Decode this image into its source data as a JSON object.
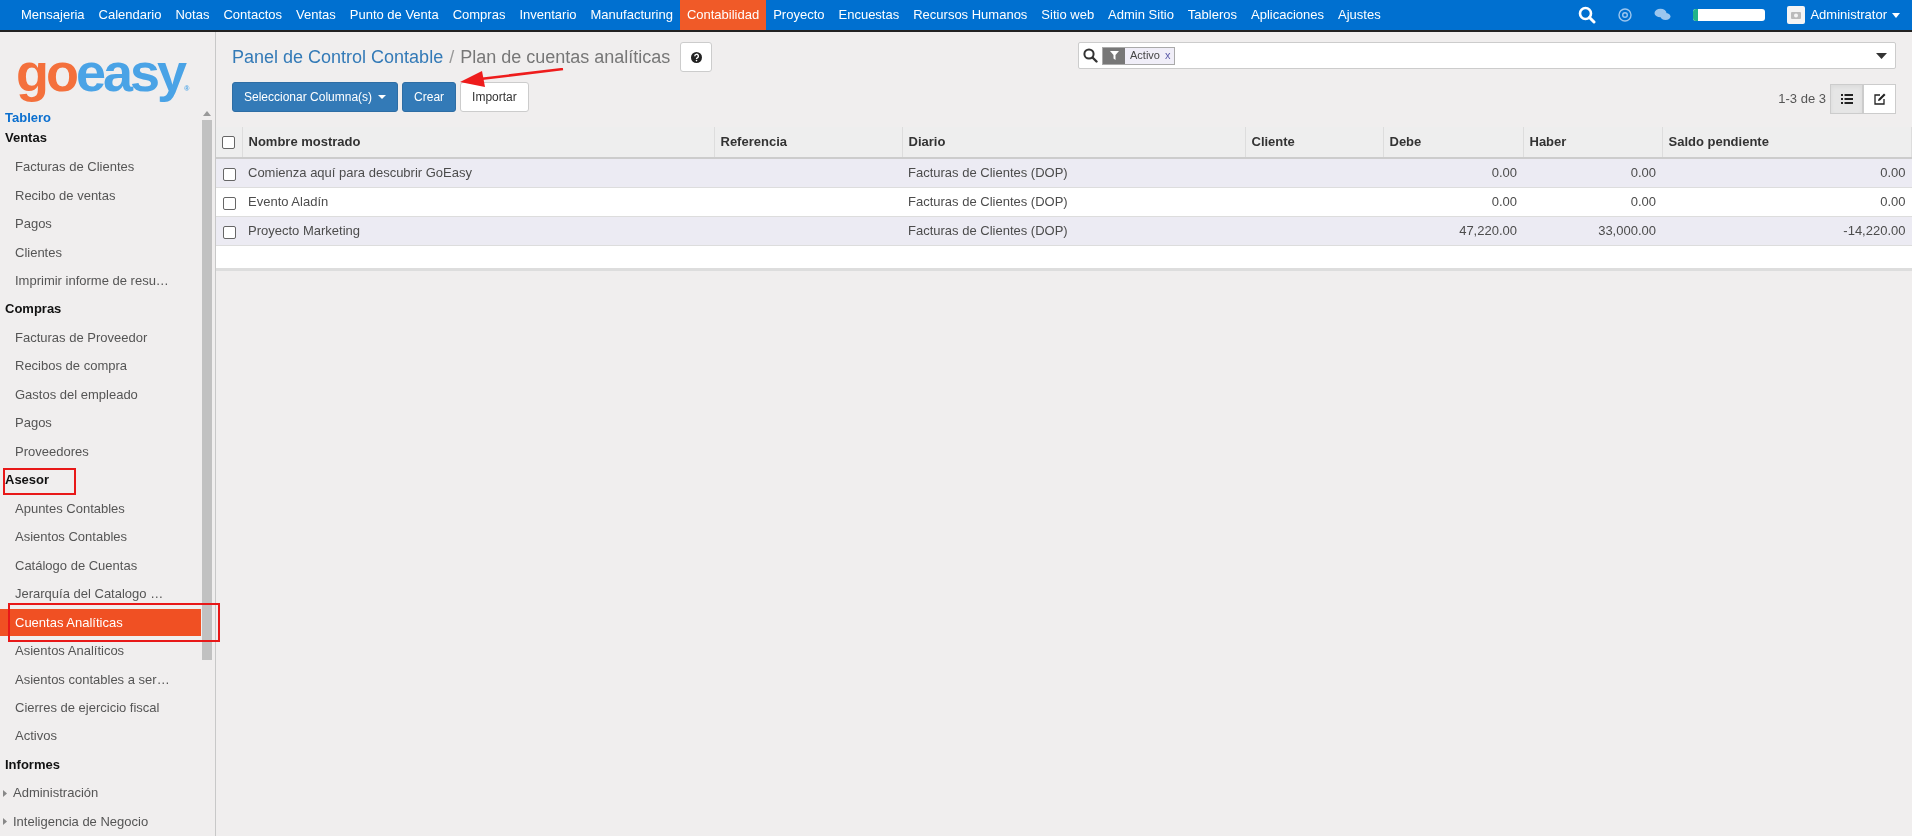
{
  "top_menu": [
    {
      "label": "Mensajeria",
      "selected": false
    },
    {
      "label": "Calendario",
      "selected": false
    },
    {
      "label": "Notas",
      "selected": false
    },
    {
      "label": "Contactos",
      "selected": false
    },
    {
      "label": "Ventas",
      "selected": false
    },
    {
      "label": "Punto de Venta",
      "selected": false
    },
    {
      "label": "Compras",
      "selected": false
    },
    {
      "label": "Inventario",
      "selected": false
    },
    {
      "label": "Manufacturing",
      "selected": false
    },
    {
      "label": "Contabilidad",
      "selected": true
    },
    {
      "label": "Proyecto",
      "selected": false
    },
    {
      "label": "Encuestas",
      "selected": false
    },
    {
      "label": "Recursos Humanos",
      "selected": false
    },
    {
      "label": "Sitio web",
      "selected": false
    },
    {
      "label": "Admin Sitio",
      "selected": false
    },
    {
      "label": "Tableros",
      "selected": false
    },
    {
      "label": "Aplicaciones",
      "selected": false
    },
    {
      "label": "Ajustes",
      "selected": false
    }
  ],
  "user": {
    "name": "Administrator",
    "progress": {
      "level": 0.06
    }
  },
  "logo": {
    "first": "go",
    "second": "easy",
    "mark": "®"
  },
  "sidebar": {
    "link": "Tablero",
    "sections": [
      {
        "title": "Ventas",
        "marked": false,
        "items": [
          {
            "label": "Facturas de Clientes",
            "selected": false
          },
          {
            "label": "Recibo de ventas",
            "selected": false
          },
          {
            "label": "Pagos",
            "selected": false
          },
          {
            "label": "Clientes",
            "selected": false
          },
          {
            "label": "Imprimir informe de resu…",
            "selected": false
          }
        ]
      },
      {
        "title": "Compras",
        "marked": false,
        "items": [
          {
            "label": "Facturas de Proveedor",
            "selected": false
          },
          {
            "label": "Recibos de compra",
            "selected": false
          },
          {
            "label": "Gastos del empleado",
            "selected": false
          },
          {
            "label": "Pagos",
            "selected": false
          },
          {
            "label": "Proveedores",
            "selected": false
          }
        ]
      },
      {
        "title": "Asesor",
        "marked": true,
        "items": [
          {
            "label": "Apuntes Contables",
            "selected": false
          },
          {
            "label": "Asientos Contables",
            "selected": false
          },
          {
            "label": "Catálogo de Cuentas",
            "selected": false
          },
          {
            "label": "Jerarquía del Catalogo …",
            "selected": false
          },
          {
            "label": "Cuentas Analíticas",
            "selected": true,
            "marked": true
          },
          {
            "label": "Asientos Analíticos",
            "selected": false
          },
          {
            "label": "Asientos contables a ser…",
            "selected": false
          },
          {
            "label": "Cierres de ejercicio fiscal",
            "selected": false
          },
          {
            "label": "Activos",
            "selected": false
          }
        ]
      },
      {
        "title": "Informes",
        "marked": false,
        "items": [
          {
            "label": "Administración",
            "selected": false,
            "expandable": true
          },
          {
            "label": "Inteligencia de Negocio",
            "selected": false,
            "expandable": true
          }
        ]
      }
    ]
  },
  "breadcrumb": {
    "parent": "Panel de Control Contable",
    "separator": "/",
    "current": "Plan de cuentas analíticas"
  },
  "buttons": [
    {
      "label": "Seleccionar Columna(s)",
      "kind": "dropdown"
    },
    {
      "label": "Crear",
      "kind": "primary"
    },
    {
      "label": "Importar",
      "kind": "default"
    }
  ],
  "arrow_annotation": true,
  "search": {
    "facets": [
      {
        "label": "Activo",
        "remove": "x"
      }
    ]
  },
  "pager": "1-3 de 3",
  "views": [
    {
      "kind": "list",
      "selected": true
    },
    {
      "kind": "form",
      "selected": false
    }
  ],
  "table": {
    "all_checked": false,
    "columns": [
      {
        "label": "Nombre mostrado",
        "kind": "text"
      },
      {
        "label": "Referencia",
        "kind": "text"
      },
      {
        "label": "Diario",
        "kind": "text"
      },
      {
        "label": "Cliente",
        "kind": "text"
      },
      {
        "label": "Debe",
        "kind": "amount"
      },
      {
        "label": "Haber",
        "kind": "amount"
      },
      {
        "label": "Saldo pendiente",
        "kind": "amount"
      }
    ],
    "rows": [
      {
        "checked": false,
        "cells": [
          "Comienza aquí para descubrir GoEasy",
          "",
          "Facturas de Clientes (DOP)",
          "",
          "0.00",
          "0.00",
          "0.00"
        ]
      },
      {
        "checked": false,
        "cells": [
          "Evento Aladín",
          "",
          "Facturas de Clientes (DOP)",
          "",
          "0.00",
          "0.00",
          "0.00"
        ]
      },
      {
        "checked": false,
        "cells": [
          "Proyecto Marketing",
          "",
          "Facturas de Clientes (DOP)",
          "",
          "47,220.00",
          "33,000.00",
          "-14,220.00"
        ]
      }
    ]
  }
}
